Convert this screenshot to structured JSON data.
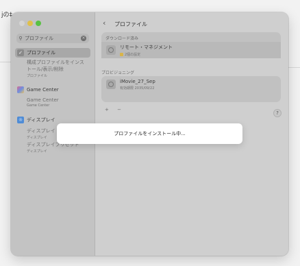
{
  "background": {
    "left_text": "jの‡"
  },
  "window": {
    "traffic_lights": [
      "close",
      "minimize",
      "zoom"
    ]
  },
  "sidebar": {
    "search_icon": "magnifier-icon",
    "search_value": "プロファイル",
    "items": [
      {
        "icon": "profile-icon",
        "label": "プロファイル",
        "selected": true
      },
      {
        "sub_main": "構成プロファイルをインストール/表示/削除",
        "sub_small": "プロファイル"
      },
      {
        "icon": "game-center-icon",
        "label": "Game Center"
      },
      {
        "sub_main": "Game Center",
        "sub_small": "Game Center"
      },
      {
        "icon": "display-icon",
        "label": "ディスプレイ"
      },
      {
        "sub_main": "ディスプレイ",
        "sub_small": "ディスプレイ"
      },
      {
        "sub_main": "ディスプレイプリセット",
        "sub_small": "ディスプレイ"
      }
    ]
  },
  "content": {
    "title": "プロファイル",
    "downloaded_header": "ダウンロード済み",
    "downloaded_row": {
      "title": "リモート・マネジメント",
      "subtitle": "2個の設定"
    },
    "provisioning_label": "プロビジョニング",
    "provisioning_row": {
      "title": "iMovie_27_Sep",
      "subtitle": "有効期限 2035/09/22"
    },
    "add_remove": "+ −",
    "help": "?"
  },
  "sheet": {
    "message": "プロファイルをインストール中..."
  }
}
